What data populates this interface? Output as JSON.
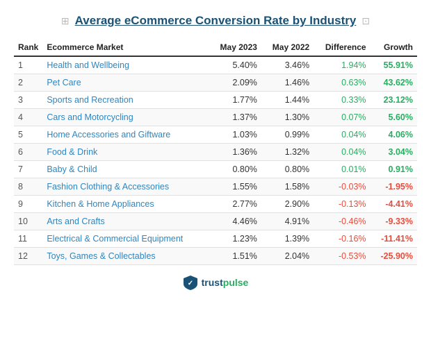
{
  "title": "Average eCommerce Conversion Rate by Industry",
  "columns": {
    "rank": "Rank",
    "market": "Ecommerce Market",
    "may2023": "May 2023",
    "may2022": "May 2022",
    "difference": "Difference",
    "growth": "Growth"
  },
  "rows": [
    {
      "rank": 1,
      "market": "Health and Wellbeing",
      "may2023": "5.40%",
      "may2022": "3.46%",
      "difference": "1.94%",
      "growth": "55.91%",
      "diffClass": "diff-pos",
      "growthClass": "growth-pos"
    },
    {
      "rank": 2,
      "market": "Pet Care",
      "may2023": "2.09%",
      "may2022": "1.46%",
      "difference": "0.63%",
      "growth": "43.62%",
      "diffClass": "diff-pos",
      "growthClass": "growth-pos"
    },
    {
      "rank": 3,
      "market": "Sports and Recreation",
      "may2023": "1.77%",
      "may2022": "1.44%",
      "difference": "0.33%",
      "growth": "23.12%",
      "diffClass": "diff-pos",
      "growthClass": "growth-pos"
    },
    {
      "rank": 4,
      "market": "Cars and Motorcycling",
      "may2023": "1.37%",
      "may2022": "1.30%",
      "difference": "0.07%",
      "growth": "5.60%",
      "diffClass": "diff-pos",
      "growthClass": "growth-pos"
    },
    {
      "rank": 5,
      "market": "Home Accessories and Giftware",
      "may2023": "1.03%",
      "may2022": "0.99%",
      "difference": "0.04%",
      "growth": "4.06%",
      "diffClass": "diff-pos",
      "growthClass": "growth-pos"
    },
    {
      "rank": 6,
      "market": "Food & Drink",
      "may2023": "1.36%",
      "may2022": "1.32%",
      "difference": "0.04%",
      "growth": "3.04%",
      "diffClass": "diff-pos",
      "growthClass": "growth-pos"
    },
    {
      "rank": 7,
      "market": "Baby & Child",
      "may2023": "0.80%",
      "may2022": "0.80%",
      "difference": "0.01%",
      "growth": "0.91%",
      "diffClass": "diff-pos",
      "growthClass": "growth-pos"
    },
    {
      "rank": 8,
      "market": "Fashion Clothing & Accessories",
      "may2023": "1.55%",
      "may2022": "1.58%",
      "difference": "-0.03%",
      "growth": "-1.95%",
      "diffClass": "diff-neg",
      "growthClass": "growth-neg"
    },
    {
      "rank": 9,
      "market": "Kitchen & Home Appliances",
      "may2023": "2.77%",
      "may2022": "2.90%",
      "difference": "-0.13%",
      "growth": "-4.41%",
      "diffClass": "diff-neg",
      "growthClass": "growth-neg"
    },
    {
      "rank": 10,
      "market": "Arts and Crafts",
      "may2023": "4.46%",
      "may2022": "4.91%",
      "difference": "-0.46%",
      "growth": "-9.33%",
      "diffClass": "diff-neg",
      "growthClass": "growth-neg"
    },
    {
      "rank": 11,
      "market": "Electrical & Commercial Equipment",
      "may2023": "1.23%",
      "may2022": "1.39%",
      "difference": "-0.16%",
      "growth": "-11.41%",
      "diffClass": "diff-neg",
      "growthClass": "growth-neg"
    },
    {
      "rank": 12,
      "market": "Toys, Games & Collectables",
      "may2023": "1.51%",
      "may2022": "2.04%",
      "difference": "-0.53%",
      "growth": "-25.90%",
      "diffClass": "diff-neg",
      "growthClass": "growth-neg"
    }
  ],
  "footer": {
    "brand": "trustpulse",
    "checkmark": "✓"
  }
}
